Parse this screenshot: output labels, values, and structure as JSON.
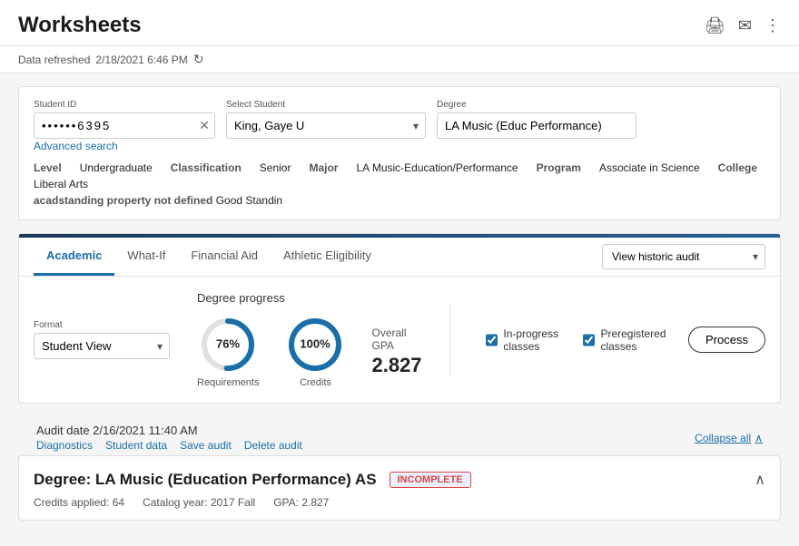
{
  "header": {
    "title": "Worksheets",
    "print_icon": "🖨",
    "email_icon": "✉",
    "more_icon": "⋮"
  },
  "refresh_bar": {
    "label": "Data refreshed",
    "date": "2/18/2021 6:46 PM",
    "refresh_icon": "↻"
  },
  "search": {
    "student_id_label": "Student ID",
    "student_id_value": "••••••6395",
    "select_student_label": "Select Student",
    "select_student_value": "King, Gaye U",
    "degree_label": "Degree",
    "degree_value": "LA Music (Educ Performance)",
    "advanced_search": "Advanced search"
  },
  "student_info": {
    "level_label": "Level",
    "level_value": "Undergraduate",
    "classification_label": "Classification",
    "classification_value": "Senior",
    "major_label": "Major",
    "major_value": "LA Music-Education/Performance",
    "program_label": "Program",
    "program_value": "Associate in Science",
    "college_label": "College",
    "college_value": "Liberal Arts",
    "acad_label": "acadstanding property not defined",
    "acad_value": "Good Standin"
  },
  "tabs": [
    {
      "id": "academic",
      "label": "Academic",
      "active": true
    },
    {
      "id": "what-if",
      "label": "What-If",
      "active": false
    },
    {
      "id": "financial-aid",
      "label": "Financial Aid",
      "active": false
    },
    {
      "id": "athletic-eligibility",
      "label": "Athletic Eligibility",
      "active": false
    }
  ],
  "view_audit": {
    "label": "View historic audit",
    "placeholder": "View historic audit"
  },
  "degree_progress": {
    "format_label": "Format",
    "format_value": "Student View",
    "title": "Degree progress",
    "requirements_pct": 76,
    "requirements_label": "Requirements",
    "credits_pct": 100,
    "credits_label": "Credits",
    "gpa_label": "Overall GPA",
    "gpa_value": "2.827",
    "in_progress_label": "In-progress classes",
    "preregistered_label": "Preregistered classes",
    "process_label": "Process"
  },
  "audit_bar": {
    "date_label": "Audit date",
    "date_value": "2/16/2021 11:40 AM",
    "links": [
      "Diagnostics",
      "Student data",
      "Save audit",
      "Delete audit"
    ],
    "collapse_all": "Collapse all"
  },
  "degree_card": {
    "title": "Degree: LA Music (Education Performance) AS",
    "badge": "INCOMPLETE",
    "credits_label": "Credits applied:",
    "credits_value": "64",
    "catalog_label": "Catalog year:",
    "catalog_value": "2017 Fall",
    "gpa_label": "GPA:",
    "gpa_value": "2.827"
  }
}
